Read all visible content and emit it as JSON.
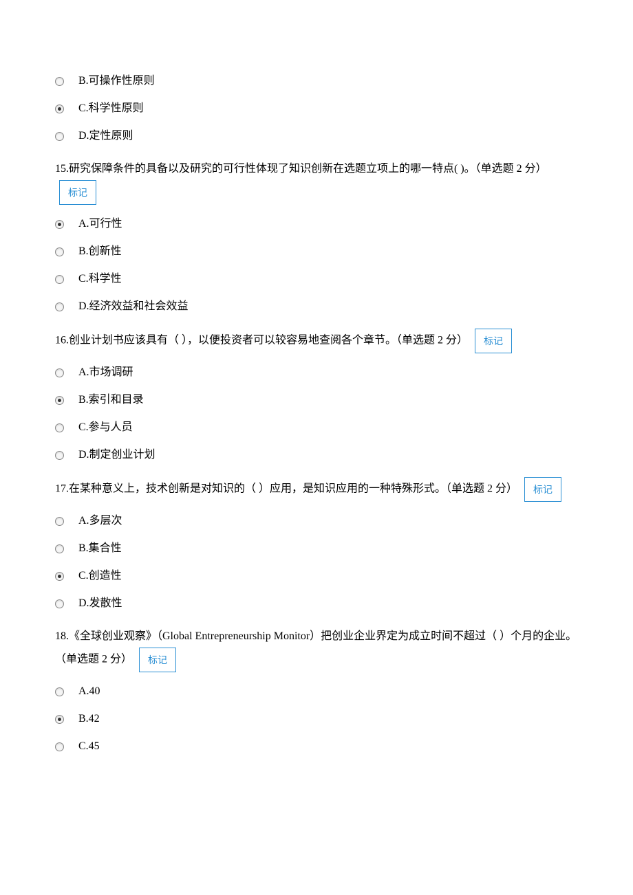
{
  "markLabel": "标记",
  "q14_partial": {
    "options": [
      {
        "label": "B.可操作性原则",
        "selected": false
      },
      {
        "label": "C.科学性原则",
        "selected": true
      },
      {
        "label": "D.定性原则",
        "selected": false
      }
    ]
  },
  "q15": {
    "text": "15.研究保障条件的具备以及研究的可行性体现了知识创新在选题立项上的哪一特点( )。（单选题 2 分）",
    "options": [
      {
        "label": "A.可行性",
        "selected": true
      },
      {
        "label": "B.创新性",
        "selected": false
      },
      {
        "label": "C.科学性",
        "selected": false
      },
      {
        "label": "D.经济效益和社会效益",
        "selected": false
      }
    ]
  },
  "q16": {
    "text": "16.创业计划书应该具有（  ），以便投资者可以较容易地查阅各个章节。（单选题 2 分）",
    "options": [
      {
        "label": "A.市场调研",
        "selected": false
      },
      {
        "label": "B.索引和目录",
        "selected": true
      },
      {
        "label": "C.参与人员",
        "selected": false
      },
      {
        "label": "D.制定创业计划",
        "selected": false
      }
    ]
  },
  "q17": {
    "text": "17.在某种意义上，技术创新是对知识的（  ）应用，是知识应用的一种特殊形式。（单选题 2 分）",
    "options": [
      {
        "label": "A.多层次",
        "selected": false
      },
      {
        "label": "B.集合性",
        "selected": false
      },
      {
        "label": "C.创造性",
        "selected": true
      },
      {
        "label": "D.发散性",
        "selected": false
      }
    ]
  },
  "q18": {
    "text_before": "18.《全球创业观察》（Global Entrepreneurship Monitor）把创业企业界定为成立时间不超过（  ）个月的企业。（单选题 2 分）",
    "options": [
      {
        "label": "A.40",
        "selected": false
      },
      {
        "label": "B.42",
        "selected": true
      },
      {
        "label": "C.45",
        "selected": false
      }
    ]
  }
}
